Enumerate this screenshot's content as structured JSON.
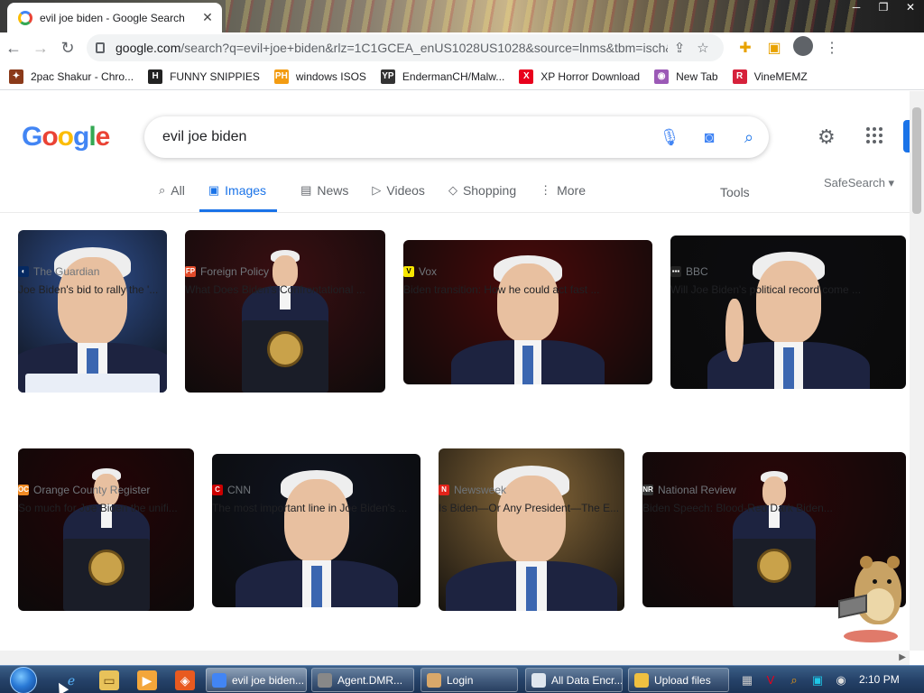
{
  "browser": {
    "tab_title": "evil joe biden - Google Search",
    "tab_close": "✕",
    "url_domain": "google.com",
    "url_rest": "/search?q=evil+joe+biden&rlz=1C1GCEA_enUS1028US1028&source=lnms&tbm=isch&sa=X&...",
    "nav": {
      "back": "←",
      "forward": "→",
      "reload": "↻"
    },
    "window_controls": [
      "─",
      "❐",
      "✕"
    ]
  },
  "bookmarks": [
    {
      "label": "2pac Shakur - Chro...",
      "icon": "tupac-icon",
      "glyph": "✦",
      "color": "#8b3a1a"
    },
    {
      "label": "FUNNY SNIPPIES",
      "icon": "h-icon",
      "glyph": "H",
      "color": "#222222"
    },
    {
      "label": "windows ISOS",
      "icon": "ph-icon",
      "glyph": "PH",
      "color": "#f39c12"
    },
    {
      "label": "EndermanCH/Malw...",
      "icon": "yp-icon",
      "glyph": "YP",
      "color": "#333333"
    },
    {
      "label": "XP Horror Download",
      "icon": "x-icon",
      "glyph": "X",
      "color": "#e8001c"
    },
    {
      "label": "New Tab",
      "icon": "globe-icon",
      "glyph": "◉",
      "color": "#9b59b6"
    },
    {
      "label": "VineMEMZ",
      "icon": "r-icon",
      "glyph": "R",
      "color": "#d6213b"
    }
  ],
  "google": {
    "logo": [
      "G",
      "o",
      "o",
      "g",
      "l",
      "e"
    ],
    "query": "evil joe biden",
    "tabs": [
      {
        "label": "All",
        "icon": "⌕",
        "active": false
      },
      {
        "label": "Images",
        "icon": "▣",
        "active": true
      },
      {
        "label": "News",
        "icon": "▤",
        "active": false
      },
      {
        "label": "Videos",
        "icon": "▷",
        "active": false
      },
      {
        "label": "Shopping",
        "icon": "◇",
        "active": false
      },
      {
        "label": "More",
        "icon": "⋮",
        "active": false
      }
    ],
    "tools": "Tools",
    "safesearch": "SafeSearch ▾"
  },
  "results": [
    {
      "source": "The Guardian",
      "fav": "◐",
      "fav_color": "#052962",
      "title": "Joe Biden's bid to rally the '...",
      "bg": "#2f4f8f"
    },
    {
      "source": "Foreign Policy",
      "fav": "FP",
      "fav_color": "#e04a2a",
      "title": "What Does Biden's Confrontational ...",
      "bg": "#3a0f12"
    },
    {
      "source": "Vox",
      "fav": "V",
      "fav_color": "#f7e600",
      "title": "Biden transition: How he could act fast ...",
      "bg": "#4a0a0a"
    },
    {
      "source": "BBC",
      "fav": "▪▪▪",
      "fav_color": "#222222",
      "title": "Will Joe Biden's political record come ...",
      "bg": "#0d0d10"
    },
    {
      "source": "Orange County Register",
      "fav": "OC",
      "fav_color": "#f08a24",
      "title": "So much for Joe Biden the unifi...",
      "bg": "#240406"
    },
    {
      "source": "CNN",
      "fav": "C",
      "fav_color": "#cc0000",
      "title": "The most important line in Joe Biden's ...",
      "bg": "#101420"
    },
    {
      "source": "Newsweek",
      "fav": "N",
      "fav_color": "#e2231a",
      "title": "Is Biden—Or Any President—The E...",
      "bg": "#8a6a3a"
    },
    {
      "source": "National Review",
      "fav": "NR",
      "fav_color": "#333333",
      "title": "Biden Speech: Blood-Red Dark Biden...",
      "bg": "#2a0608"
    }
  ],
  "taskbar": {
    "buttons": [
      {
        "label": "evil joe biden...",
        "icon": "chrome-icon",
        "active": true
      },
      {
        "label": "Agent.DMR...",
        "icon": "app-icon",
        "active": false
      },
      {
        "label": "Login",
        "icon": "login-icon",
        "active": false
      },
      {
        "label": "All Data Encr...",
        "icon": "folder-icon",
        "active": false
      },
      {
        "label": "Upload files",
        "icon": "upload-icon",
        "active": false
      }
    ],
    "clock": "2:10 PM"
  }
}
